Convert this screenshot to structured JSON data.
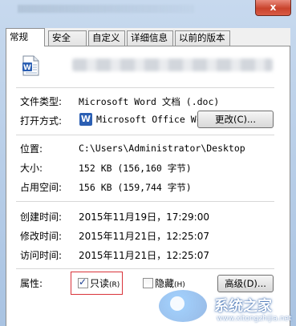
{
  "window": {
    "close_label": "x"
  },
  "tabs": [
    {
      "label": "常规",
      "active": true
    },
    {
      "label": "安全",
      "active": false
    },
    {
      "label": "自定义",
      "active": false
    },
    {
      "label": "详细信息",
      "active": false
    },
    {
      "label": "以前的版本",
      "active": false
    }
  ],
  "general": {
    "file_type_label": "文件类型:",
    "file_type_value": "Microsoft Word 文档 (.doc)",
    "open_with_label": "打开方式:",
    "open_with_value": "Microsoft Office Wc",
    "change_button": "更改(C)...",
    "location_label": "位置:",
    "location_value": "C:\\Users\\Administrator\\Desktop",
    "size_label": "大小:",
    "size_value": "152 KB (156,160 字节)",
    "size_on_disk_label": "占用空间:",
    "size_on_disk_value": "156 KB (159,744 字节)",
    "created_label": "创建时间:",
    "created_value": "2015年11月19日，17:29:00",
    "modified_label": "修改时间:",
    "modified_value": "2015年11月21日，12:25:07",
    "accessed_label": "访问时间:",
    "accessed_value": "2015年11月21日，12:25:07",
    "attributes_label": "属性:",
    "readonly_label": "只读",
    "readonly_shortcut": "(R)",
    "readonly_checked": true,
    "hidden_label": "隐藏",
    "hidden_shortcut": "(H)",
    "hidden_checked": false,
    "advanced_button": "高级(D)..."
  },
  "watermark": {
    "text": "系统之家",
    "url": "www.xitongzhijia.net"
  },
  "icons": {
    "document": "word-document-icon",
    "open_with": "word-app-icon",
    "logo": "watermark-logo-icon"
  },
  "colors": {
    "close_button": "#c9432c",
    "highlight_border": "#d9333a",
    "word_blue": "#2b5fb3"
  }
}
